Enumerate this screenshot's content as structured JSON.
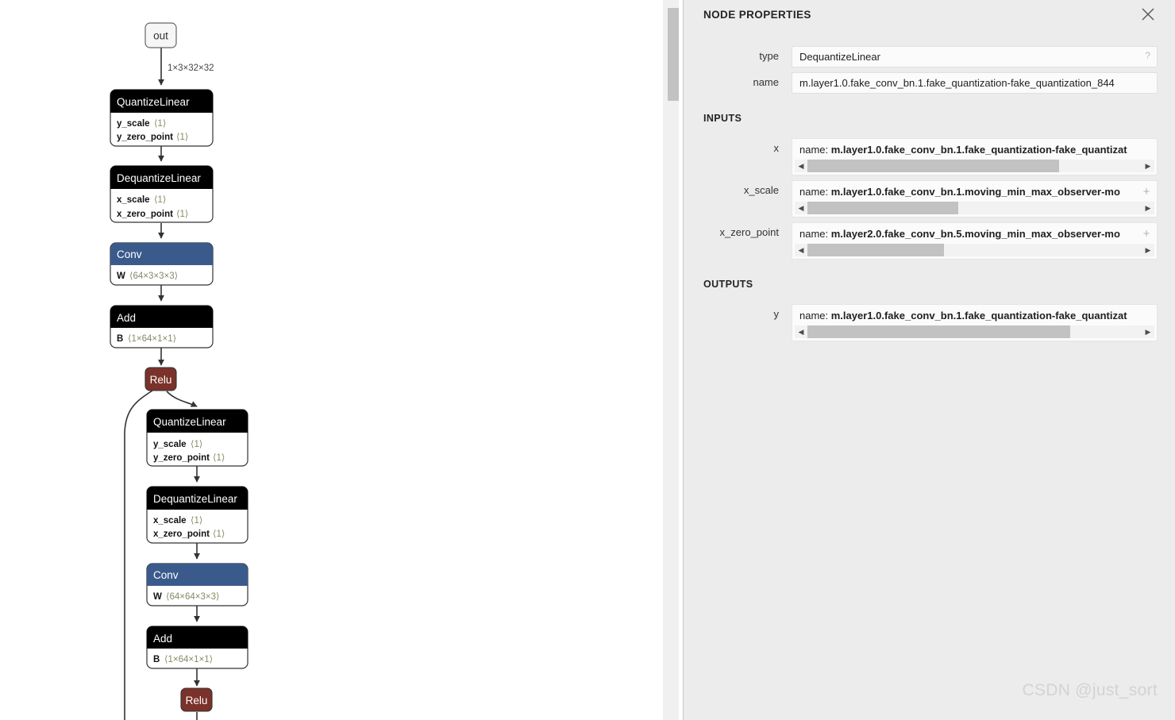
{
  "graph": {
    "input_node": {
      "label": "out",
      "type": "io"
    },
    "edge_labels": [
      {
        "text": "1×3×32×32"
      }
    ],
    "nodes": [
      {
        "id": "quantizelinear-1",
        "title": "QuantizeLinear",
        "header_color": "#000000",
        "attributes": [
          {
            "name": "y_scale",
            "value": "⟨1⟩"
          },
          {
            "name": "y_zero_point",
            "value": "⟨1⟩"
          }
        ]
      },
      {
        "id": "dequantizelinear-1",
        "title": "DequantizeLinear",
        "header_color": "#000000",
        "attributes": [
          {
            "name": "x_scale",
            "value": "⟨1⟩"
          },
          {
            "name": "x_zero_point",
            "value": "⟨1⟩"
          }
        ]
      },
      {
        "id": "conv-1",
        "title": "Conv",
        "header_color": "#3b5a8c",
        "attributes": [
          {
            "name": "W",
            "value": "⟨64×3×3×3⟩"
          }
        ]
      },
      {
        "id": "add-1",
        "title": "Add",
        "header_color": "#000000",
        "attributes": [
          {
            "name": "B",
            "value": "⟨1×64×1×1⟩"
          }
        ]
      },
      {
        "id": "relu-1",
        "title": "Relu",
        "header_color": "#7a322a",
        "attributes": []
      },
      {
        "id": "quantizelinear-2",
        "title": "QuantizeLinear",
        "header_color": "#000000",
        "attributes": [
          {
            "name": "y_scale",
            "value": "⟨1⟩"
          },
          {
            "name": "y_zero_point",
            "value": "⟨1⟩"
          }
        ]
      },
      {
        "id": "dequantizelinear-2",
        "title": "DequantizeLinear",
        "header_color": "#000000",
        "attributes": [
          {
            "name": "x_scale",
            "value": "⟨1⟩"
          },
          {
            "name": "x_zero_point",
            "value": "⟨1⟩"
          }
        ]
      },
      {
        "id": "conv-2",
        "title": "Conv",
        "header_color": "#3b5a8c",
        "attributes": [
          {
            "name": "W",
            "value": "⟨64×64×3×3⟩"
          }
        ]
      },
      {
        "id": "add-2",
        "title": "Add",
        "header_color": "#000000",
        "attributes": [
          {
            "name": "B",
            "value": "⟨1×64×1×1⟩"
          }
        ]
      },
      {
        "id": "relu-2",
        "title": "Relu",
        "header_color": "#7a322a",
        "attributes": []
      }
    ],
    "node_text": {
      "out": "out",
      "quantizelinear_1_title": "QuantizeLinear",
      "q1_a0_name": "y_scale",
      "q1_a0_val": "⟨1⟩",
      "q1_a1_name": "y_zero_point",
      "q1_a1_val": "⟨1⟩",
      "dequantizelinear_1_title": "DequantizeLinear",
      "d1_a0_name": "x_scale",
      "d1_a0_val": "⟨1⟩",
      "d1_a1_name": "x_zero_point",
      "d1_a1_val": "⟨1⟩",
      "conv_1_title": "Conv",
      "c1_a0_name": "W",
      "c1_a0_val": "⟨64×3×3×3⟩",
      "add_1_title": "Add",
      "ad1_a0_name": "B",
      "ad1_a0_val": "⟨1×64×1×1⟩",
      "relu_1_title": "Relu",
      "quantizelinear_2_title": "QuantizeLinear",
      "q2_a0_name": "y_scale",
      "q2_a0_val": "⟨1⟩",
      "q2_a1_name": "y_zero_point",
      "q2_a1_val": "⟨1⟩",
      "dequantizelinear_2_title": "DequantizeLinear",
      "d2_a0_name": "x_scale",
      "d2_a0_val": "⟨1⟩",
      "d2_a1_name": "x_zero_point",
      "d2_a1_val": "⟨1⟩",
      "conv_2_title": "Conv",
      "c2_a0_name": "W",
      "c2_a0_val": "⟨64×64×3×3⟩",
      "add_2_title": "Add",
      "ad2_a0_name": "B",
      "ad2_a0_val": "⟨1×64×1×1⟩",
      "relu_2_title": "Relu",
      "edge_label_1": "1×3×32×32"
    }
  },
  "sidebar": {
    "title": "NODE PROPERTIES",
    "close_icon": "close-icon",
    "properties": [
      {
        "label": "type",
        "value": "DequantizeLinear",
        "help": "?"
      },
      {
        "label": "name",
        "value": "m.layer1.0.fake_conv_bn.1.fake_quantization-fake_quantization_844"
      }
    ],
    "property_text": {
      "type_label": "type",
      "type_value": "DequantizeLinear",
      "type_help": "?",
      "name_label": "name",
      "name_value": "m.layer1.0.fake_conv_bn.1.fake_quantization-fake_quantization_844"
    },
    "inputs_title": "INPUTS",
    "inputs": [
      {
        "label": "x",
        "prefix": "name: ",
        "value": "m.layer1.0.fake_conv_bn.1.fake_quantization-fake_quantizat",
        "has_plus": false,
        "scroll_thumb_pct": 70
      },
      {
        "label": "x_scale",
        "prefix": "name: ",
        "value": "m.layer1.0.fake_conv_bn.1.moving_min_max_observer-mo",
        "has_plus": true,
        "plus_icon": "+",
        "scroll_thumb_pct": 42
      },
      {
        "label": "x_zero_point",
        "prefix": "name: ",
        "value": "m.layer2.0.fake_conv_bn.5.moving_min_max_observer-mo",
        "has_plus": true,
        "plus_icon": "+",
        "scroll_thumb_pct": 38
      }
    ],
    "input_text": {
      "x_label": "x",
      "x_prefix": "name: ",
      "x_value": "m.layer1.0.fake_conv_bn.1.fake_quantization-fake_quantizat",
      "xscale_label": "x_scale",
      "xscale_prefix": "name: ",
      "xscale_value": "m.layer1.0.fake_conv_bn.1.moving_min_max_observer-mo",
      "xzp_label": "x_zero_point",
      "xzp_prefix": "name: ",
      "xzp_value": "m.layer2.0.fake_conv_bn.5.moving_min_max_observer-mo",
      "plus": "+"
    },
    "outputs_title": "OUTPUTS",
    "outputs": [
      {
        "label": "y",
        "prefix": "name: ",
        "value": "m.layer1.0.fake_conv_bn.1.fake_quantization-fake_quantizat",
        "scroll_thumb_pct": 73
      }
    ],
    "output_text": {
      "y_label": "y",
      "y_prefix": "name: ",
      "y_value": "m.layer1.0.fake_conv_bn.1.fake_quantization-fake_quantizat"
    },
    "scroll_arrows": {
      "left": "◀",
      "right": "▶"
    }
  },
  "watermark": "CSDN @just_sort",
  "colors": {
    "node_header_default": "#000000",
    "node_header_conv": "#3b5a8c",
    "node_header_relu": "#7a322a",
    "node_body": "#ffffff",
    "sidebar_bg": "#ececec",
    "field_bg": "#fbfbfb",
    "scroll_thumb": "#c2c2c2",
    "attr_value": "#888866"
  }
}
